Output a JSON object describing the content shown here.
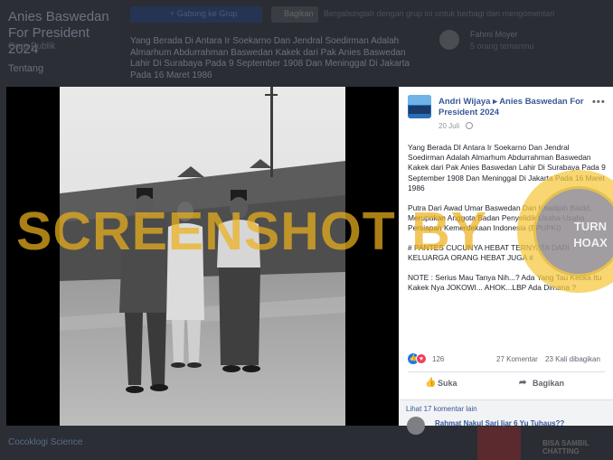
{
  "background": {
    "group_title": "Anies Baswedan For President 2024",
    "group_sub": "Grup Publik",
    "nav_item": "Tentang",
    "join_button": "+ Gabung ke Grup",
    "share_button": "Bagikan",
    "top_text": "Bergabunglah dengan grup ini untuk berbagi dan mengomentari",
    "caption": "Yang Berada Di Antara Ir Soekarno Dan Jendral Soedirman Adalah Almarhum Abdurrahman Baswedan Kakek dari Pak Anies Baswedan Lahir Di Surabaya Pada 9 September 1908 Dan Meninggal Di Jakarta Pada 16 Maret 1986",
    "right_name": "Fahmi Moyer",
    "right_sub": "5 orang temanmu",
    "bottom_link": "Cocoklogi Science",
    "ad_text": "BISA SAMBIL CHATTING"
  },
  "post": {
    "author": "Andri Wijaya",
    "arrow": "▸",
    "group": "Anies Baswedan For President 2024",
    "date": "20 Juli",
    "paragraphs": [
      "Yang Berada DI Antara Ir Soekarno Dan Jendral Soedirman Adalah Almarhum Abdurrahman Baswedan Kakek dari Pak Anies Baswedan Lahir Di Surabaya Pada 9 September 1908 Dan Meninggal Di Jakarta Pada 16 Maret 1986",
      "Putra Dari Awad Umar Baswedan Dan Khadijah Badid, Merupakan Anggota Badan Penyelidik Usaha-Usaha Persiapan Kemerdekaan Indonesia (BPUPKI)",
      "# PANTES CUCUNYA HEBAT TERNYATA DARI KELUARGA ORANG HEBAT JUGA #",
      "NOTE : Serius Mau Tanya Nih...? Ada Yang Tau Ketika Itu Kakek Nya JOKOWI... AHOK...LBP Ada Dimana ?"
    ],
    "reaction_count": "126",
    "comment_count": "27 Komentar",
    "share_count": "23 Kali dibagikan",
    "like_label": "Suka",
    "share_label": "Bagikan",
    "see_comments": "Lihat 17 komentar lain",
    "commenter_line": "Rahmat Nakul Sari Ijar 6 Yu Tuhaus??"
  },
  "watermark": {
    "text": "SCREENSHOT BY",
    "seal_word1": "TURN",
    "seal_word2": "HOAX"
  },
  "colors": {
    "accent": "#385898",
    "like": "#1877f2",
    "love": "#f33e58"
  }
}
